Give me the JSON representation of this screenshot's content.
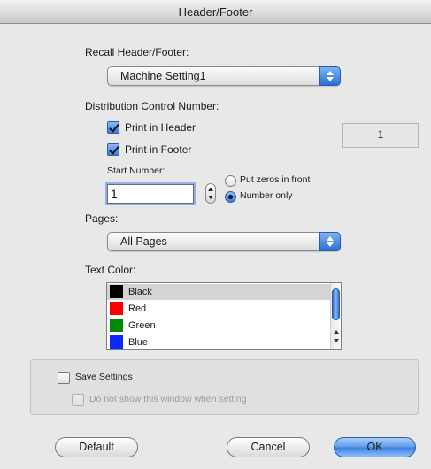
{
  "window": {
    "title": "Header/Footer"
  },
  "recall": {
    "label": "Recall Header/Footer:",
    "selected": "Machine Setting1"
  },
  "distribution": {
    "label": "Distribution Control Number:",
    "print_in_header": {
      "label": "Print in Header",
      "checked": true
    },
    "print_in_footer": {
      "label": "Print in Footer",
      "checked": true
    },
    "preview_value": "1",
    "start_number_label": "Start Number:",
    "start_number_value": "1",
    "format_options": [
      {
        "label": "Put zeros in front",
        "selected": false
      },
      {
        "label": "Number only",
        "selected": true
      }
    ]
  },
  "pages": {
    "label": "Pages:",
    "selected": "All Pages"
  },
  "text_color": {
    "label": "Text Color:",
    "items": [
      {
        "label": "Black",
        "color": "#000000",
        "selected": true
      },
      {
        "label": "Red",
        "color": "#ff0000",
        "selected": false
      },
      {
        "label": "Green",
        "color": "#008c00",
        "selected": false
      },
      {
        "label": "Blue",
        "color": "#0a28ff",
        "selected": false
      }
    ]
  },
  "save_settings": {
    "label": "Save Settings",
    "checked": false,
    "no_show_label": "Do not show this window when setting",
    "no_show_enabled": false
  },
  "buttons": {
    "default": "Default",
    "cancel": "Cancel",
    "ok": "OK"
  }
}
